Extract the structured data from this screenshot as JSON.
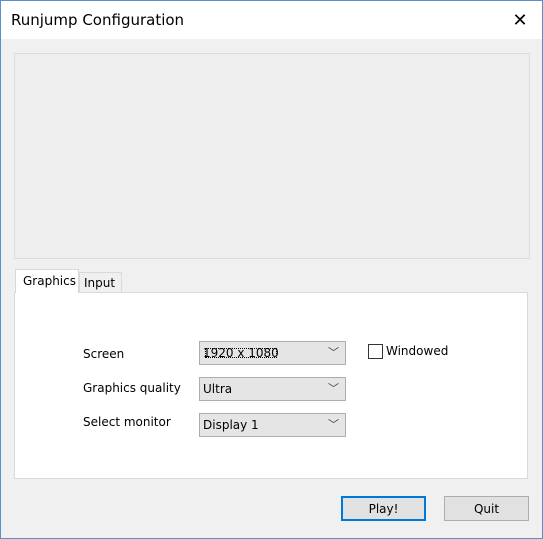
{
  "window": {
    "title": "Runjump Configuration",
    "close_icon": "close-icon"
  },
  "tabs": [
    {
      "label": "Graphics",
      "active": true
    },
    {
      "label": "Input",
      "active": false
    }
  ],
  "graphics": {
    "screen": {
      "label": "Screen",
      "value": "1920 x 1080"
    },
    "quality": {
      "label": "Graphics quality",
      "value": "Ultra"
    },
    "monitor": {
      "label": "Select monitor",
      "value": "Display 1"
    },
    "windowed": {
      "label": "Windowed",
      "checked": false
    }
  },
  "buttons": {
    "play": "Play!",
    "quit": "Quit"
  },
  "colors": {
    "accent": "#0078d7"
  }
}
